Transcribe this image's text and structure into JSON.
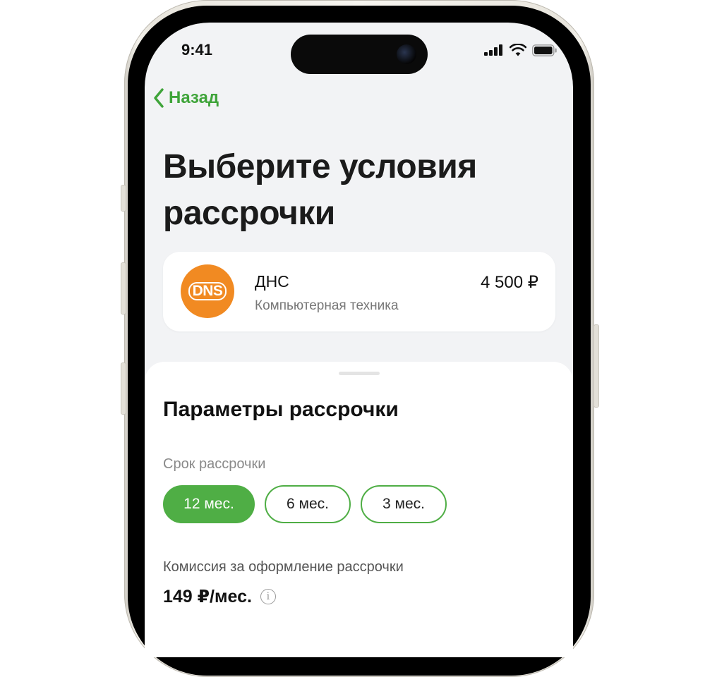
{
  "status_bar": {
    "time": "9:41"
  },
  "nav": {
    "back_label": "Назад"
  },
  "page": {
    "title": "Выберите условия рассрочки"
  },
  "merchant": {
    "logo_text": "DNS",
    "name": "ДНС",
    "category": "Компьютерная техника",
    "amount": "4 500 ₽"
  },
  "sheet": {
    "title": "Параметры рассрочки",
    "term_label": "Срок рассрочки",
    "term_options": [
      {
        "label": "12 мес.",
        "selected": true
      },
      {
        "label": "6 мес.",
        "selected": false
      },
      {
        "label": "3 мес.",
        "selected": false
      }
    ],
    "fee_label": "Комиссия за оформление рассрочки",
    "fee_value": "149 ₽/мес.",
    "info_icon": "info-icon"
  },
  "colors": {
    "accent_green": "#4fae45",
    "back_green": "#3fa43a",
    "dns_orange": "#f18a22",
    "screen_bg": "#f2f3f5"
  }
}
